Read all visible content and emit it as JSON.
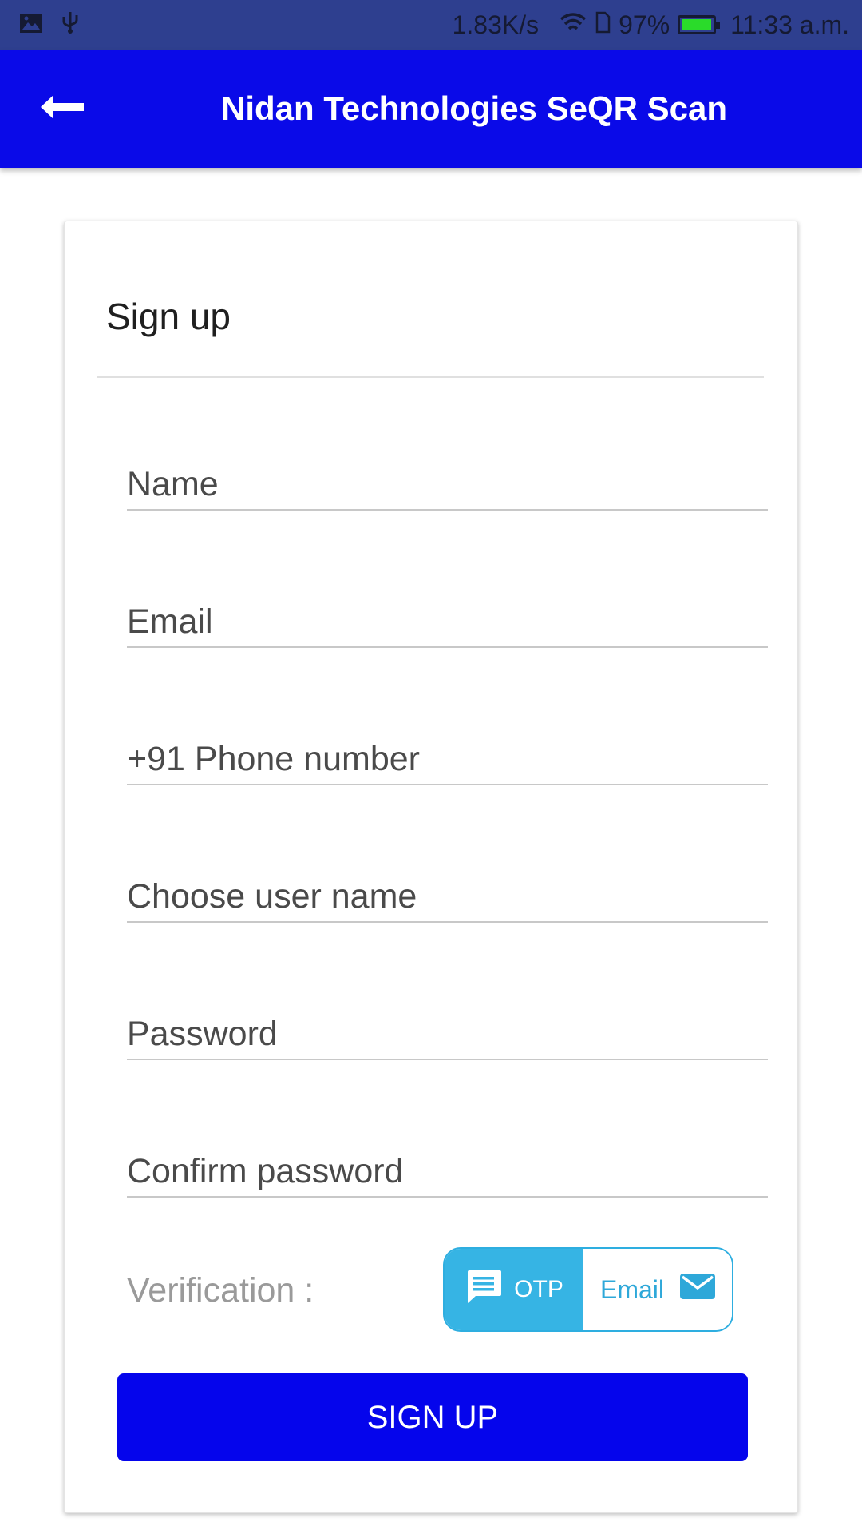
{
  "status_bar": {
    "left_icons": [
      "image-icon",
      "usb-icon"
    ],
    "network_speed": "1.83K/s",
    "battery_percent": "97%",
    "battery_level": 0.97,
    "time": "11:33 a.m."
  },
  "app_bar": {
    "title": "Nidan Technologies SeQR Scan",
    "back_icon": "back-arrow-icon",
    "color": "#0a0ae8"
  },
  "form": {
    "title": "Sign up",
    "fields": {
      "name": {
        "placeholder": "Name",
        "value": ""
      },
      "email": {
        "placeholder": "Email",
        "value": ""
      },
      "phone": {
        "placeholder": "+91 Phone number",
        "value": ""
      },
      "username": {
        "placeholder": "Choose user name",
        "value": ""
      },
      "password": {
        "placeholder": "Password",
        "value": ""
      },
      "confirm_password": {
        "placeholder": "Confirm password",
        "value": ""
      }
    },
    "verification": {
      "label": "Verification :",
      "options": [
        {
          "label": "OTP",
          "icon": "message-icon",
          "selected": true
        },
        {
          "label": "Email",
          "icon": "envelope-icon",
          "selected": false
        }
      ],
      "accent_color": "#36b4e4"
    },
    "submit_label": "SIGN UP",
    "submit_color": "#0505ec"
  }
}
